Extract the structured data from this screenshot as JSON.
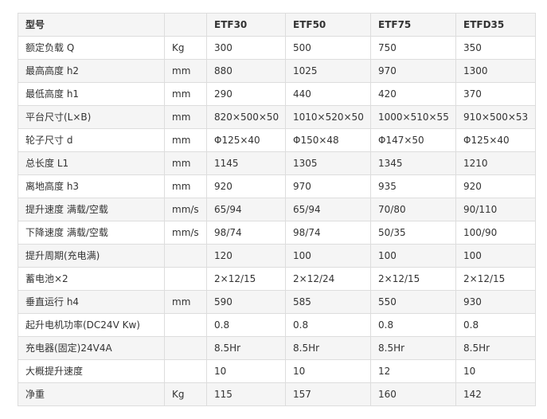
{
  "header": {
    "label": "型号",
    "unit": "",
    "models": [
      "ETF30",
      "ETF50",
      "ETF75",
      "ETFD35"
    ]
  },
  "rows": [
    {
      "label": "额定负载 Q",
      "unit": "Kg",
      "values": [
        "300",
        "500",
        "750",
        "350"
      ]
    },
    {
      "label": "最高高度 h2",
      "unit": "mm",
      "values": [
        "880",
        "1025",
        "970",
        "1300"
      ]
    },
    {
      "label": "最低高度 h1",
      "unit": "mm",
      "values": [
        "290",
        "440",
        "420",
        "370"
      ]
    },
    {
      "label": "平台尺寸(L×B)",
      "unit": "mm",
      "values": [
        "820×500×50",
        "1010×520×50",
        "1000×510×55",
        "910×500×53"
      ]
    },
    {
      "label": "轮子尺寸 d",
      "unit": "mm",
      "values": [
        "Φ125×40",
        "Φ150×48",
        "Φ147×50",
        "Φ125×40"
      ]
    },
    {
      "label": "总长度 L1",
      "unit": "mm",
      "values": [
        "1145",
        "1305",
        "1345",
        "1210"
      ]
    },
    {
      "label": "离地高度 h3",
      "unit": "mm",
      "values": [
        "920",
        "970",
        "935",
        "920"
      ]
    },
    {
      "label": "提升速度 满载/空载",
      "unit": "mm/s",
      "values": [
        "65/94",
        "65/94",
        "70/80",
        "90/110"
      ]
    },
    {
      "label": "下降速度 满载/空载",
      "unit": "mm/s",
      "values": [
        "98/74",
        "98/74",
        "50/35",
        "100/90"
      ]
    },
    {
      "label": "提升周期(充电满)",
      "unit": "",
      "values": [
        "120",
        "100",
        "100",
        "100"
      ]
    },
    {
      "label": "蓄电池×2",
      "unit": "",
      "values": [
        "2×12/15",
        "2×12/24",
        "2×12/15",
        "2×12/15"
      ]
    },
    {
      "label": "垂直运行 h4",
      "unit": "mm",
      "values": [
        "590",
        "585",
        "550",
        "930"
      ]
    },
    {
      "label": "起升电机功率(DC24V Kw)",
      "unit": "",
      "values": [
        "0.8",
        "0.8",
        "0.8",
        "0.8"
      ]
    },
    {
      "label": "充电器(固定)24V4A",
      "unit": "",
      "values": [
        "8.5Hr",
        "8.5Hr",
        "8.5Hr",
        "8.5Hr"
      ]
    },
    {
      "label": "大概提升速度",
      "unit": "",
      "values": [
        "10",
        "10",
        "12",
        "10"
      ]
    },
    {
      "label": "净重",
      "unit": "Kg",
      "values": [
        "115",
        "157",
        "160",
        "142"
      ]
    }
  ],
  "colors": {
    "border": "#dddddd",
    "zebra_row": "#f5f5f5",
    "text": "#333333"
  }
}
